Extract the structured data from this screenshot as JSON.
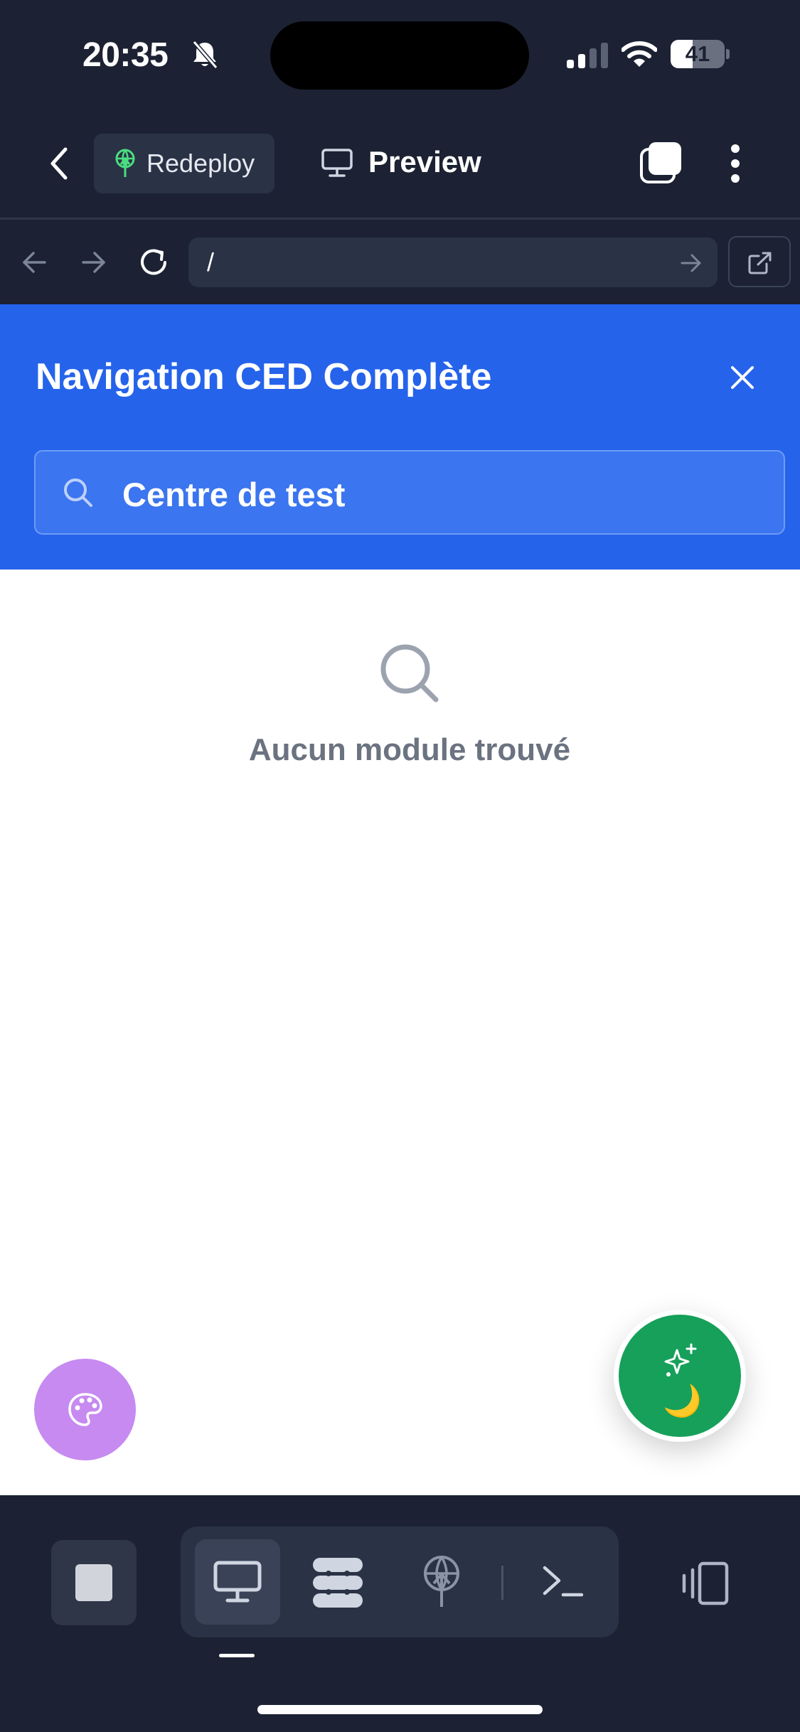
{
  "status_bar": {
    "time": "20:35",
    "battery": "41",
    "battery_level_percent": 41,
    "icons": [
      "bell-slash-icon",
      "signal-icon",
      "wifi-icon",
      "battery-icon"
    ]
  },
  "app_bar": {
    "back_icon": "chevron-left-icon",
    "redeploy_label": "Redeploy",
    "redeploy_icon": "deploy-antenna-icon",
    "preview_label": "Preview",
    "preview_icon": "monitor-icon",
    "actions": [
      "tabs-icon",
      "more-vertical-icon"
    ]
  },
  "browser_bar": {
    "url": "/",
    "icons": [
      "arrow-left-icon",
      "arrow-right-icon",
      "reload-icon",
      "go-arrow-icon",
      "external-link-icon"
    ]
  },
  "panel": {
    "title": "Navigation CED Complète",
    "close_icon": "close-icon",
    "search_value": "Centre de test",
    "search_icon": "search-icon",
    "header_color": "#2563eb"
  },
  "empty_state": {
    "icon": "search-icon",
    "message": "Aucun module trouvé"
  },
  "fabs": {
    "palette": {
      "icon": "palette-icon",
      "color": "#c68af0"
    },
    "ai": {
      "icons": [
        "sparkles-icon",
        "moon-icon"
      ],
      "moon": "🌙",
      "color": "#16a05a"
    }
  },
  "bottom_toolbar": {
    "items": [
      "stop-button",
      "monitor-icon",
      "dots-grid-icon",
      "deploy-antenna-icon",
      "terminal-icon",
      "device-rotate-icon"
    ],
    "active": "monitor-icon"
  }
}
